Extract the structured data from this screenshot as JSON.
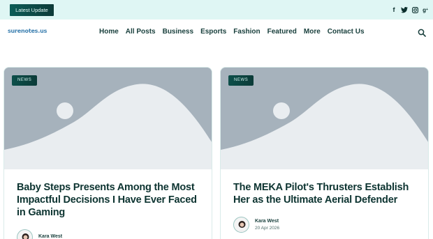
{
  "topbar": {
    "latest_label": "Latest Update",
    "socials": [
      "facebook-icon",
      "twitter-icon",
      "instagram-icon",
      "google-plus-icon"
    ]
  },
  "header": {
    "logo": "surenotes.us",
    "nav": [
      "Home",
      "All Posts",
      "Business",
      "Esports",
      "Fashion",
      "Featured",
      "More",
      "Contact Us"
    ]
  },
  "posts": [
    {
      "badge": "NEWS",
      "title": "Baby Steps Presents Among the Most Impactful Decisions I Have Ever Faced in Gaming",
      "author": "Kara West",
      "date": ""
    },
    {
      "badge": "NEWS",
      "title": "The MEKA Pilot's Thrusters Establish Her as the Ultimate Aerial Defender",
      "author": "Kara West",
      "date": "20 Apr 2026"
    }
  ],
  "colors": {
    "accent": "#0b4f4a",
    "topbar_bg": "#dff6f4",
    "placeholder": "#a6b2bc"
  }
}
